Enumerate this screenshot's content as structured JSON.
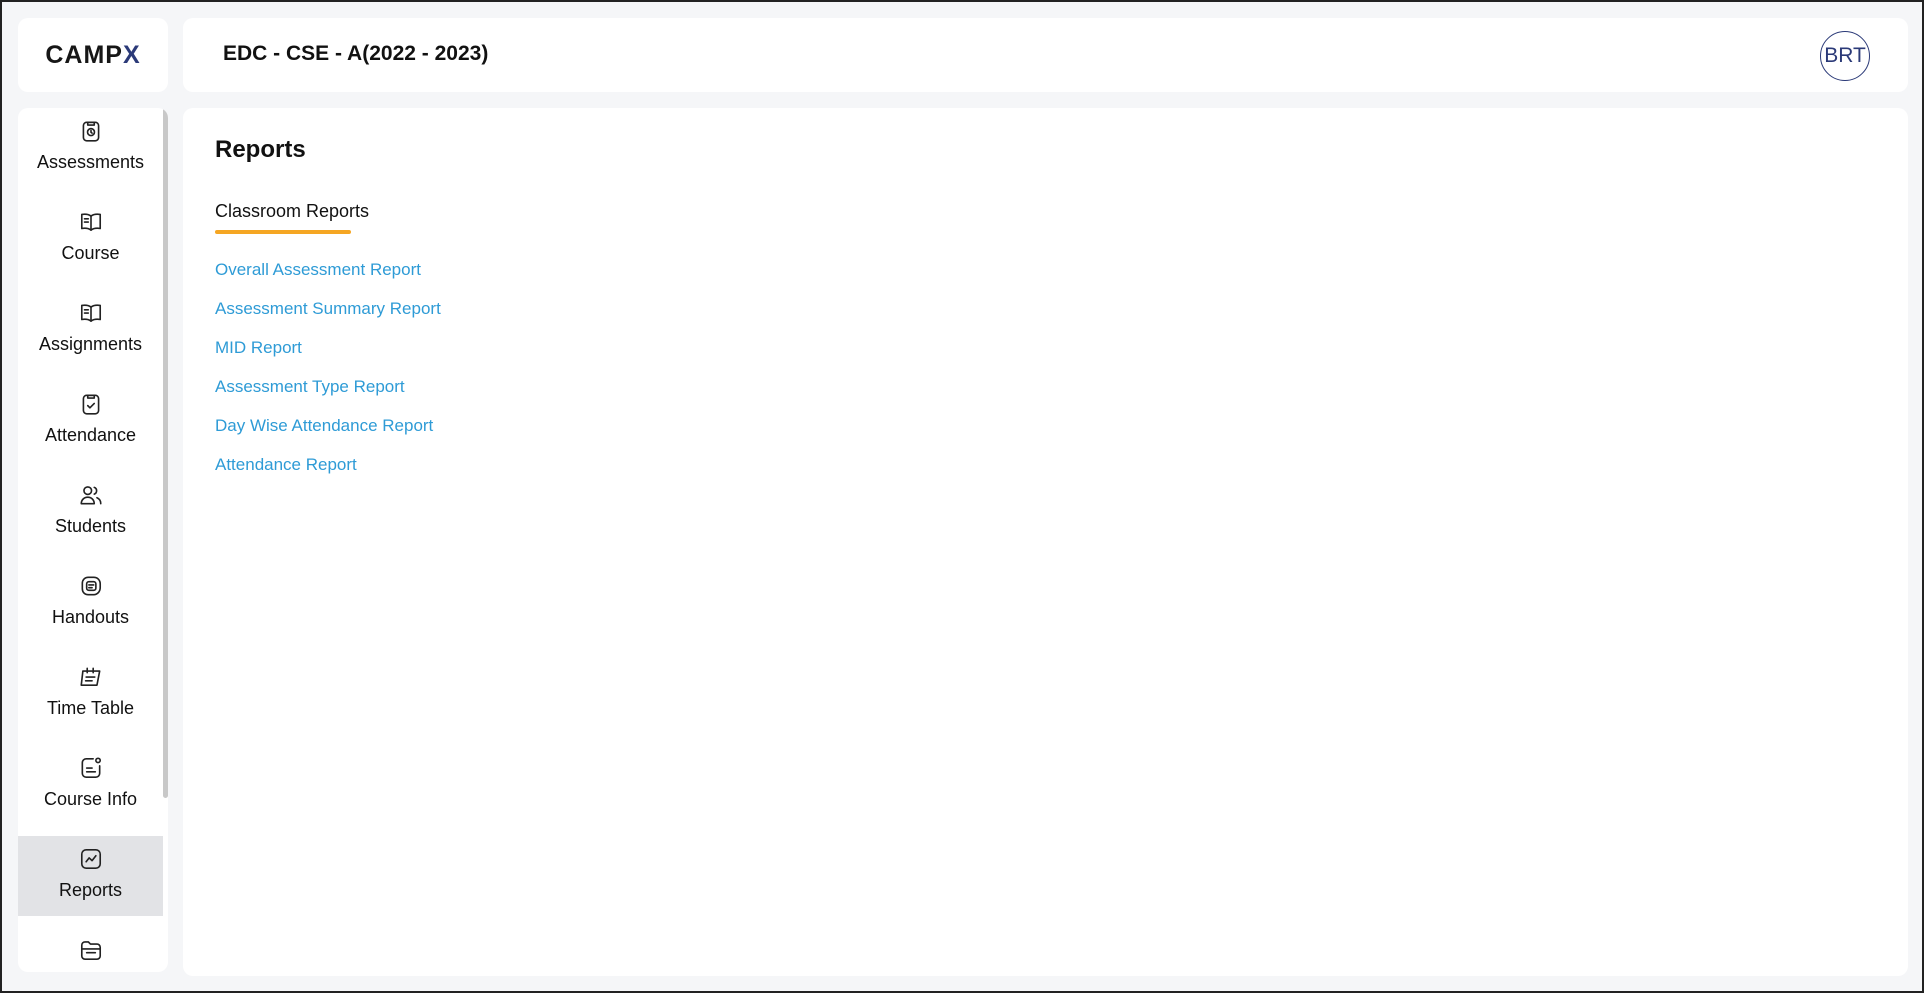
{
  "brand": {
    "logo_main": "CAMP",
    "logo_x": "X"
  },
  "header": {
    "title": "EDC - CSE - A(2022 - 2023)",
    "avatar_initials": "BRT"
  },
  "sidebar": {
    "items": [
      {
        "label": "Assessments",
        "icon": "clipboard-clock-icon"
      },
      {
        "label": "Course",
        "icon": "open-book-icon"
      },
      {
        "label": "Assignments",
        "icon": "open-book-icon"
      },
      {
        "label": "Attendance",
        "icon": "clipboard-check-icon"
      },
      {
        "label": "Students",
        "icon": "users-icon"
      },
      {
        "label": "Handouts",
        "icon": "handout-icon"
      },
      {
        "label": "Time Table",
        "icon": "calendar-icon"
      },
      {
        "label": "Course Info",
        "icon": "info-card-icon"
      },
      {
        "label": "Reports",
        "icon": "chart-icon",
        "active": true
      },
      {
        "label": "",
        "icon": "folder-icon"
      }
    ]
  },
  "main": {
    "title": "Reports",
    "tab": "Classroom Reports",
    "reports": [
      "Overall Assessment Report",
      "Assessment Summary Report",
      "MID Report",
      "Assessment Type Report",
      "Day Wise Attendance Report",
      "Attendance Report"
    ]
  },
  "colors": {
    "accent_underline": "#f5a623",
    "link": "#2e9bd6",
    "brand_x": "#2b3a78",
    "active_bg": "#e2e3e6"
  }
}
